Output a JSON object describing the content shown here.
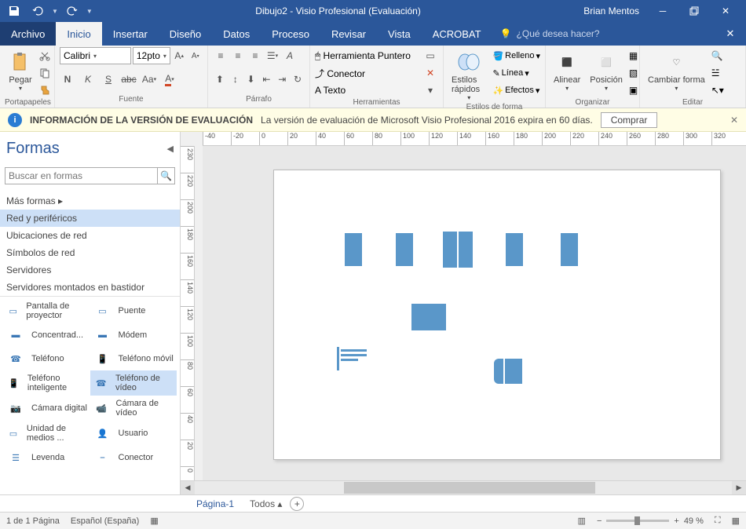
{
  "titlebar": {
    "title": "Dibujo2 - Visio Profesional (Evaluación)",
    "user": "Brian Mentos"
  },
  "tabs": {
    "file": "Archivo",
    "items": [
      "Inicio",
      "Insertar",
      "Diseño",
      "Datos",
      "Proceso",
      "Revisar",
      "Vista",
      "ACROBAT"
    ],
    "active_index": 0,
    "tell_me": "¿Qué desea hacer?"
  },
  "ribbon": {
    "clipboard": {
      "paste": "Pegar",
      "label": "Portapapeles"
    },
    "font": {
      "family": "Calibri",
      "size": "12pto",
      "label": "Fuente"
    },
    "paragraph": {
      "label": "Párrafo"
    },
    "tools": {
      "pointer": "Herramienta Puntero",
      "connector": "Conector",
      "text": "Texto",
      "label": "Herramientas"
    },
    "styles": {
      "quick": "Estilos rápidos",
      "fill": "Relleno",
      "line": "Línea",
      "effects": "Efectos",
      "label": "Estilos de forma"
    },
    "arrange": {
      "align": "Alinear",
      "position": "Posición",
      "label": "Organizar"
    },
    "edit": {
      "change": "Cambiar forma",
      "label": "Editar"
    }
  },
  "evalbar": {
    "heading": "INFORMACIÓN DE LA VERSIÓN DE EVALUACIÓN",
    "message": "La versión de evaluación de Microsoft Visio Profesional 2016 expira en 60 días.",
    "buy": "Comprar"
  },
  "shapes": {
    "title": "Formas",
    "search_placeholder": "Buscar en formas",
    "more": "Más formas",
    "categories": [
      "Red y periféricos",
      "Ubicaciones de red",
      "Símbolos de red",
      "Servidores",
      "Servidores montados en bastidor"
    ],
    "selected_category": 0,
    "stencil": [
      [
        "Pantalla de proyector",
        "Puente"
      ],
      [
        "Concentrad...",
        "Módem"
      ],
      [
        "Teléfono",
        "Teléfono móvil"
      ],
      [
        "Teléfono inteligente",
        "Teléfono de vídeo"
      ],
      [
        "Cámara digital",
        "Cámara de vídeo"
      ],
      [
        "Unidad de medios ...",
        "Usuario"
      ],
      [
        "Levenda",
        "Conector"
      ]
    ],
    "selected_shape": [
      3,
      1
    ]
  },
  "ruler_x": [
    "-40",
    "-20",
    "0",
    "20",
    "40",
    "60",
    "80",
    "100",
    "120",
    "140",
    "160",
    "180",
    "200",
    "220",
    "240",
    "260",
    "280",
    "300",
    "320"
  ],
  "ruler_y": [
    "230",
    "220",
    "200",
    "180",
    "160",
    "140",
    "120",
    "100",
    "80",
    "60",
    "40",
    "20",
    "0"
  ],
  "page_tabs": {
    "page": "Página-1",
    "all": "Todos"
  },
  "status": {
    "pages": "1 de 1 Página",
    "lang": "Español (España)",
    "zoom": "49 %"
  }
}
